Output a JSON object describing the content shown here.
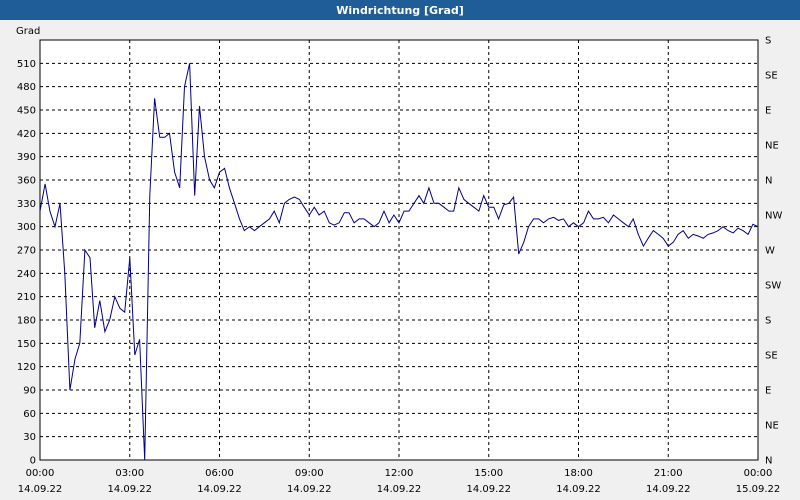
{
  "window": {
    "title": "Windrichtung [Grad]"
  },
  "chart_data": {
    "type": "line",
    "title": "Windrichtung [Grad]",
    "ylabel": "Grad",
    "xlabel": "",
    "ylim": [
      0,
      540
    ],
    "xlim_hours": [
      0,
      24
    ],
    "grid": true,
    "y_ticks": [
      0,
      30,
      60,
      90,
      120,
      150,
      180,
      210,
      240,
      270,
      300,
      330,
      360,
      390,
      420,
      450,
      480,
      510
    ],
    "right_ticks": [
      {
        "v": 0,
        "label": "N"
      },
      {
        "v": 45,
        "label": "NE"
      },
      {
        "v": 90,
        "label": "E"
      },
      {
        "v": 135,
        "label": "SE"
      },
      {
        "v": 180,
        "label": "S"
      },
      {
        "v": 225,
        "label": "SW"
      },
      {
        "v": 270,
        "label": "W"
      },
      {
        "v": 315,
        "label": "NW"
      },
      {
        "v": 360,
        "label": "N"
      },
      {
        "v": 405,
        "label": "NE"
      },
      {
        "v": 450,
        "label": "E"
      },
      {
        "v": 495,
        "label": "SE"
      },
      {
        "v": 540,
        "label": "S"
      }
    ],
    "x_ticks": [
      {
        "h": 0,
        "time": "00:00",
        "date": "14.09.22"
      },
      {
        "h": 3,
        "time": "03:00",
        "date": "14.09.22"
      },
      {
        "h": 6,
        "time": "06:00",
        "date": "14.09.22"
      },
      {
        "h": 9,
        "time": "09:00",
        "date": "14.09.22"
      },
      {
        "h": 12,
        "time": "12:00",
        "date": "14.09.22"
      },
      {
        "h": 15,
        "time": "15:00",
        "date": "14.09.22"
      },
      {
        "h": 18,
        "time": "18:00",
        "date": "14.09.22"
      },
      {
        "h": 21,
        "time": "21:00",
        "date": "14.09.22"
      },
      {
        "h": 24,
        "time": "00:00",
        "date": "15.09.22"
      }
    ],
    "series": [
      {
        "color": "#00008b",
        "points": [
          [
            0.0,
            320
          ],
          [
            0.17,
            355
          ],
          [
            0.33,
            320
          ],
          [
            0.5,
            300
          ],
          [
            0.67,
            330
          ],
          [
            0.83,
            240
          ],
          [
            1.0,
            90
          ],
          [
            1.17,
            130
          ],
          [
            1.33,
            150
          ],
          [
            1.5,
            270
          ],
          [
            1.67,
            260
          ],
          [
            1.83,
            170
          ],
          [
            2.0,
            205
          ],
          [
            2.17,
            165
          ],
          [
            2.33,
            180
          ],
          [
            2.5,
            210
          ],
          [
            2.67,
            195
          ],
          [
            2.83,
            190
          ],
          [
            3.0,
            260
          ],
          [
            3.17,
            135
          ],
          [
            3.33,
            155
          ],
          [
            3.5,
            0
          ],
          [
            3.67,
            340
          ],
          [
            3.83,
            465
          ],
          [
            4.0,
            415
          ],
          [
            4.17,
            415
          ],
          [
            4.33,
            420
          ],
          [
            4.5,
            370
          ],
          [
            4.67,
            350
          ],
          [
            4.83,
            480
          ],
          [
            5.0,
            510
          ],
          [
            5.17,
            340
          ],
          [
            5.33,
            455
          ],
          [
            5.5,
            390
          ],
          [
            5.67,
            360
          ],
          [
            5.83,
            350
          ],
          [
            6.0,
            370
          ],
          [
            6.17,
            375
          ],
          [
            6.33,
            350
          ],
          [
            6.5,
            330
          ],
          [
            6.67,
            310
          ],
          [
            6.83,
            295
          ],
          [
            7.0,
            300
          ],
          [
            7.17,
            295
          ],
          [
            7.33,
            300
          ],
          [
            7.5,
            305
          ],
          [
            7.67,
            310
          ],
          [
            7.83,
            320
          ],
          [
            8.0,
            305
          ],
          [
            8.17,
            330
          ],
          [
            8.33,
            335
          ],
          [
            8.5,
            338
          ],
          [
            8.67,
            335
          ],
          [
            8.83,
            325
          ],
          [
            9.0,
            315
          ],
          [
            9.17,
            325
          ],
          [
            9.33,
            315
          ],
          [
            9.5,
            320
          ],
          [
            9.67,
            305
          ],
          [
            9.83,
            302
          ],
          [
            10.0,
            305
          ],
          [
            10.17,
            318
          ],
          [
            10.33,
            318
          ],
          [
            10.5,
            305
          ],
          [
            10.67,
            310
          ],
          [
            10.83,
            310
          ],
          [
            11.0,
            305
          ],
          [
            11.17,
            300
          ],
          [
            11.33,
            305
          ],
          [
            11.5,
            320
          ],
          [
            11.67,
            305
          ],
          [
            11.83,
            315
          ],
          [
            12.0,
            305
          ],
          [
            12.17,
            320
          ],
          [
            12.33,
            320
          ],
          [
            12.5,
            330
          ],
          [
            12.67,
            340
          ],
          [
            12.83,
            330
          ],
          [
            13.0,
            350
          ],
          [
            13.17,
            330
          ],
          [
            13.33,
            330
          ],
          [
            13.5,
            325
          ],
          [
            13.67,
            320
          ],
          [
            13.83,
            320
          ],
          [
            14.0,
            350
          ],
          [
            14.17,
            335
          ],
          [
            14.33,
            330
          ],
          [
            14.5,
            325
          ],
          [
            14.67,
            320
          ],
          [
            14.83,
            340
          ],
          [
            15.0,
            325
          ],
          [
            15.17,
            325
          ],
          [
            15.33,
            310
          ],
          [
            15.5,
            328
          ],
          [
            15.67,
            330
          ],
          [
            15.83,
            338
          ],
          [
            16.0,
            265
          ],
          [
            16.17,
            280
          ],
          [
            16.33,
            300
          ],
          [
            16.5,
            310
          ],
          [
            16.67,
            310
          ],
          [
            16.83,
            305
          ],
          [
            17.0,
            310
          ],
          [
            17.17,
            312
          ],
          [
            17.33,
            308
          ],
          [
            17.5,
            310
          ],
          [
            17.67,
            300
          ],
          [
            17.83,
            305
          ],
          [
            18.0,
            300
          ],
          [
            18.17,
            305
          ],
          [
            18.33,
            320
          ],
          [
            18.5,
            310
          ],
          [
            18.67,
            310
          ],
          [
            18.83,
            312
          ],
          [
            19.0,
            305
          ],
          [
            19.17,
            315
          ],
          [
            19.33,
            310
          ],
          [
            19.5,
            305
          ],
          [
            19.67,
            300
          ],
          [
            19.83,
            310
          ],
          [
            20.0,
            290
          ],
          [
            20.17,
            275
          ],
          [
            20.33,
            285
          ],
          [
            20.5,
            295
          ],
          [
            20.67,
            290
          ],
          [
            20.83,
            285
          ],
          [
            21.0,
            275
          ],
          [
            21.17,
            280
          ],
          [
            21.33,
            290
          ],
          [
            21.5,
            295
          ],
          [
            21.67,
            285
          ],
          [
            21.83,
            290
          ],
          [
            22.0,
            288
          ],
          [
            22.17,
            285
          ],
          [
            22.33,
            290
          ],
          [
            22.5,
            292
          ],
          [
            22.67,
            295
          ],
          [
            22.83,
            300
          ],
          [
            23.0,
            295
          ],
          [
            23.17,
            292
          ],
          [
            23.33,
            298
          ],
          [
            23.5,
            295
          ],
          [
            23.67,
            290
          ],
          [
            23.83,
            303
          ],
          [
            24.0,
            300
          ]
        ]
      }
    ]
  }
}
